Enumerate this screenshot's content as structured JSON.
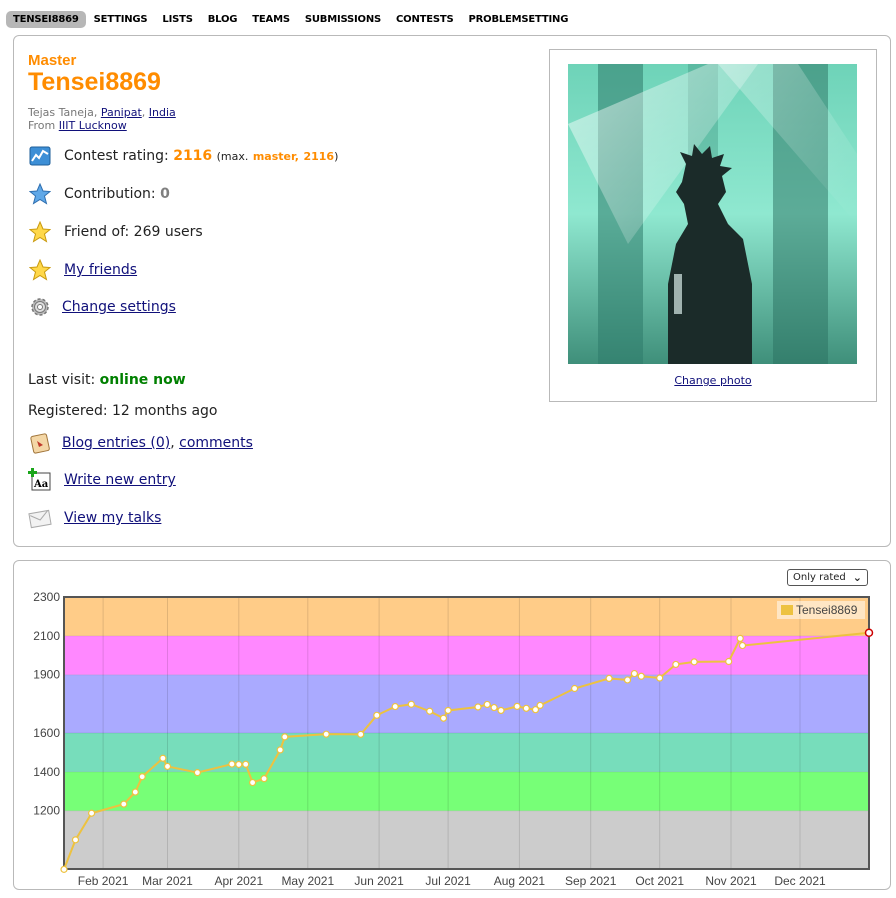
{
  "nav": {
    "tabs": [
      {
        "label": "TENSEI8869",
        "active": true
      },
      {
        "label": "SETTINGS"
      },
      {
        "label": "LISTS"
      },
      {
        "label": "BLOG"
      },
      {
        "label": "TEAMS"
      },
      {
        "label": "SUBMISSIONS"
      },
      {
        "label": "CONTESTS"
      },
      {
        "label": "PROBLEMSETTING"
      }
    ]
  },
  "profile": {
    "rank": "Master",
    "handle": "Tensei8869",
    "name_prefix": "Tejas Taneja,",
    "city": "Panipat",
    "country": "India",
    "from_label": "From",
    "organization": "IIIT Lucknow",
    "contest_rating_label": "Contest rating:",
    "contest_rating": "2116",
    "max_prefix": "(max.",
    "max_rank": "master,",
    "max_rating": "2116",
    "max_suffix": ")",
    "contribution_label": "Contribution:",
    "contribution": "0",
    "friend_of": "Friend of: 269 users",
    "my_friends": "My friends",
    "change_settings": "Change settings",
    "last_visit_label": "Last visit:",
    "last_visit": "online now",
    "registered": "Registered: 12 months ago",
    "blog_entries": "Blog entries (0)",
    "comments": "comments",
    "write_new_entry": "Write new entry",
    "view_my_talks": "View my talks",
    "change_photo": "Change photo",
    "colors": {
      "rank": "#ff8c00",
      "online": "#008000",
      "link": "#10107a"
    }
  },
  "filter": {
    "selected": "Only rated"
  },
  "chart_data": {
    "type": "line",
    "series": [
      {
        "name": "Tensei8869",
        "color": "#edc240",
        "points": [
          [
            "2021-01-15",
            898
          ],
          [
            "2021-01-20",
            1050
          ],
          [
            "2021-01-27",
            1187
          ],
          [
            "2021-02-10",
            1234
          ],
          [
            "2021-02-15",
            1296
          ],
          [
            "2021-02-18",
            1375
          ],
          [
            "2021-02-27",
            1470
          ],
          [
            "2021-03-01",
            1428
          ],
          [
            "2021-03-14",
            1396
          ],
          [
            "2021-03-29",
            1440
          ],
          [
            "2021-04-01",
            1438
          ],
          [
            "2021-04-04",
            1439
          ],
          [
            "2021-04-07",
            1345
          ],
          [
            "2021-04-12",
            1365
          ],
          [
            "2021-04-19",
            1513
          ],
          [
            "2021-04-21",
            1580
          ],
          [
            "2021-05-09",
            1594
          ],
          [
            "2021-05-24",
            1593
          ],
          [
            "2021-05-31",
            1691
          ],
          [
            "2021-06-08",
            1736
          ],
          [
            "2021-06-15",
            1748
          ],
          [
            "2021-06-23",
            1712
          ],
          [
            "2021-06-29",
            1676
          ],
          [
            "2021-07-01",
            1716
          ],
          [
            "2021-07-14",
            1734
          ],
          [
            "2021-07-18",
            1747
          ],
          [
            "2021-07-21",
            1731
          ],
          [
            "2021-07-24",
            1716
          ],
          [
            "2021-07-31",
            1737
          ],
          [
            "2021-08-04",
            1727
          ],
          [
            "2021-08-08",
            1720
          ],
          [
            "2021-08-10",
            1742
          ],
          [
            "2021-08-25",
            1829
          ],
          [
            "2021-09-09",
            1881
          ],
          [
            "2021-09-17",
            1873
          ],
          [
            "2021-09-20",
            1906
          ],
          [
            "2021-09-23",
            1892
          ],
          [
            "2021-10-01",
            1883
          ],
          [
            "2021-10-08",
            1953
          ],
          [
            "2021-10-16",
            1966
          ],
          [
            "2021-10-31",
            1968
          ],
          [
            "2021-11-05",
            2087
          ],
          [
            "2021-11-06",
            2050
          ],
          [
            "2021-12-31",
            2116
          ]
        ]
      }
    ],
    "y_ticks": [
      1200,
      1400,
      1600,
      1900,
      2100,
      2300
    ],
    "x_ticks": [
      {
        "date": "2021-02-01",
        "label": "Feb 2021"
      },
      {
        "date": "2021-03-01",
        "label": "Mar 2021"
      },
      {
        "date": "2021-04-01",
        "label": "Apr 2021"
      },
      {
        "date": "2021-05-01",
        "label": "May 2021"
      },
      {
        "date": "2021-06-01",
        "label": "Jun 2021"
      },
      {
        "date": "2021-07-01",
        "label": "Jul 2021"
      },
      {
        "date": "2021-08-01",
        "label": "Aug 2021"
      },
      {
        "date": "2021-09-01",
        "label": "Sep 2021"
      },
      {
        "date": "2021-10-01",
        "label": "Oct 2021"
      },
      {
        "date": "2021-11-01",
        "label": "Nov 2021"
      },
      {
        "date": "2021-12-01",
        "label": "Dec 2021"
      }
    ],
    "xlim": [
      "2021-01-15",
      "2021-12-31"
    ],
    "ylim": [
      900,
      2300
    ],
    "bands": [
      {
        "from": 0,
        "to": 1200,
        "color": "#cccccc"
      },
      {
        "from": 1200,
        "to": 1400,
        "color": "#77ff77"
      },
      {
        "from": 1400,
        "to": 1600,
        "color": "#77ddbb"
      },
      {
        "from": 1600,
        "to": 1900,
        "color": "#aaaaff"
      },
      {
        "from": 1900,
        "to": 2100,
        "color": "#ff88ff"
      },
      {
        "from": 2100,
        "to": 2300,
        "color": "#ffcc88"
      }
    ],
    "grid": true,
    "legend": "top-right"
  }
}
